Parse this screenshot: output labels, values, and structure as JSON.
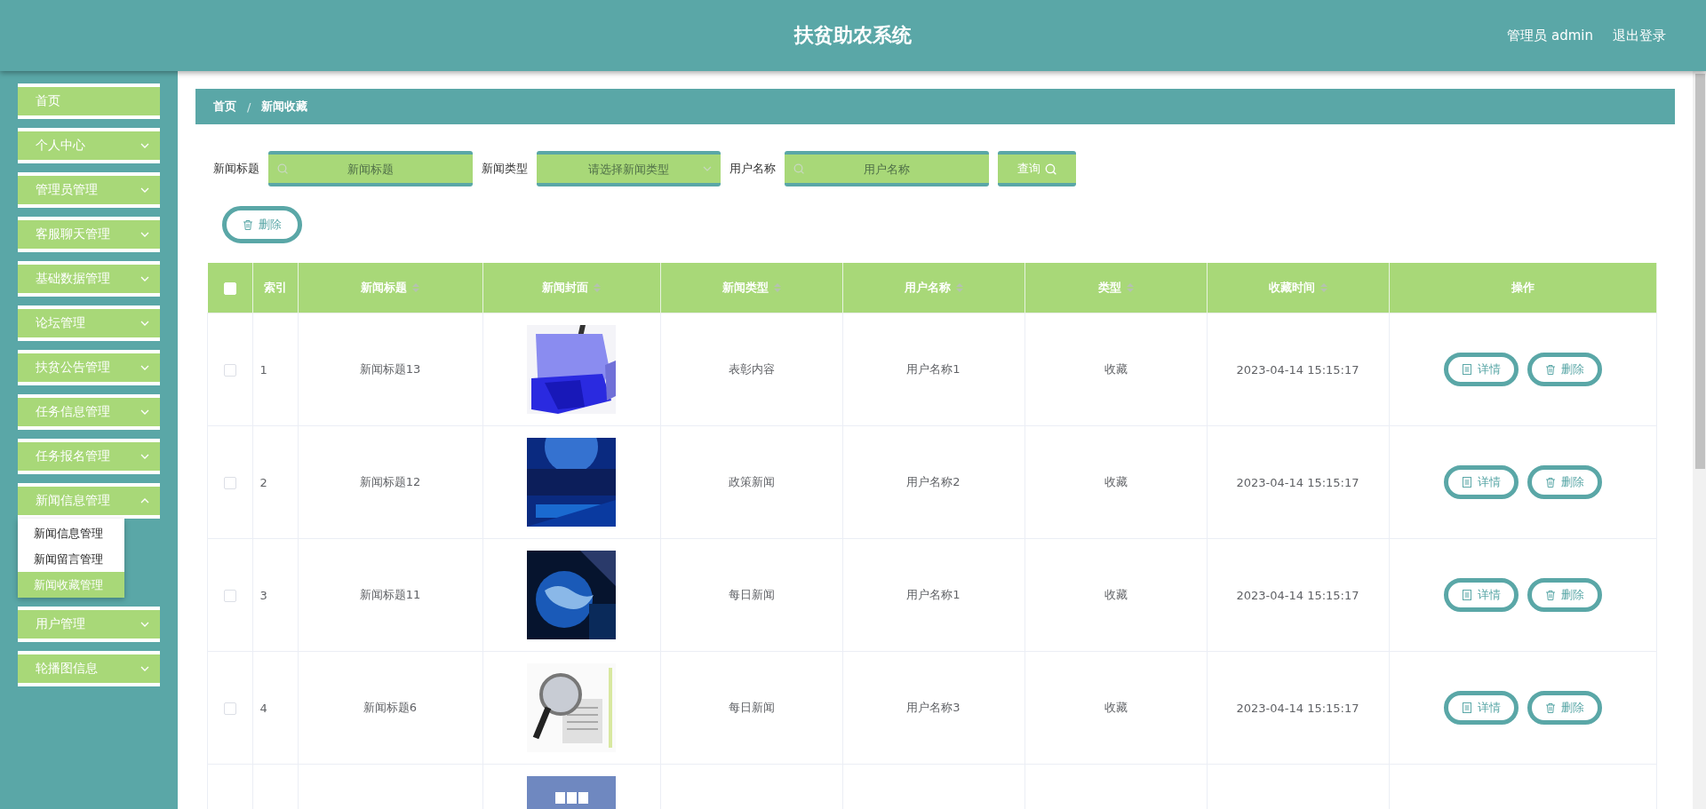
{
  "header": {
    "title": "扶贫助农系统",
    "user": "管理员 admin",
    "logout": "退出登录"
  },
  "sidebar": {
    "items": [
      {
        "label": "首页",
        "selected": false
      },
      {
        "label": "个人中心",
        "selected": false,
        "expanded": false
      },
      {
        "label": "管理员管理",
        "selected": false,
        "expanded": false
      },
      {
        "label": "客服聊天管理",
        "selected": false,
        "expanded": false
      },
      {
        "label": "基础数据管理",
        "selected": false,
        "expanded": false
      },
      {
        "label": "论坛管理",
        "selected": false,
        "expanded": false
      },
      {
        "label": "扶贫公告管理",
        "selected": false,
        "expanded": false
      },
      {
        "label": "任务信息管理",
        "selected": false,
        "expanded": false
      },
      {
        "label": "任务报名管理",
        "selected": false,
        "expanded": false
      },
      {
        "label": "新闻信息管理",
        "selected": false,
        "expanded": true,
        "children": [
          {
            "label": "新闻信息管理",
            "selected": false
          },
          {
            "label": "新闻留言管理",
            "selected": false
          },
          {
            "label": "新闻收藏管理",
            "selected": true
          }
        ]
      },
      {
        "label": "用户管理",
        "selected": false,
        "expanded": false
      },
      {
        "label": "轮播图信息",
        "selected": false,
        "expanded": false
      }
    ]
  },
  "breadcrumb": [
    "首页",
    "/",
    "新闻收藏"
  ],
  "search": {
    "fields": [
      {
        "kind": "input",
        "label": "新闻标题",
        "placeholder": "新闻标题"
      },
      {
        "kind": "select",
        "label": "新闻类型",
        "placeholder": "请选择新闻类型"
      },
      {
        "kind": "input",
        "label": "用户名称",
        "placeholder": "用户名称"
      }
    ],
    "button": "查询"
  },
  "delete_button": "删除",
  "table": {
    "select_all": {
      "checked": false
    },
    "columns": [
      {
        "label": "索引",
        "sortable": false
      },
      {
        "label": "新闻标题",
        "sortable": true
      },
      {
        "label": "新闻封面",
        "sortable": true
      },
      {
        "label": "新闻类型",
        "sortable": true
      },
      {
        "label": "用户名称",
        "sortable": true
      },
      {
        "label": "类型",
        "sortable": true
      },
      {
        "label": "收藏时间",
        "sortable": true
      },
      {
        "label": "操作",
        "sortable": false
      }
    ],
    "rows": [
      {
        "checked": false,
        "index": "1",
        "title": "新闻标题13",
        "cover": {
          "kind": "picture"
        },
        "news_type": "表彰内容",
        "user_name": "用户名称1",
        "type": "收藏",
        "time": "2023-04-14 15:15:17",
        "actions": [
          "详情",
          "删除"
        ]
      },
      {
        "checked": false,
        "index": "2",
        "title": "新闻标题12",
        "cover": {
          "kind": "picture"
        },
        "news_type": "政策新闻",
        "user_name": "用户名称2",
        "type": "收藏",
        "time": "2023-04-14 15:15:17",
        "actions": [
          "详情",
          "删除"
        ]
      },
      {
        "checked": false,
        "index": "3",
        "title": "新闻标题11",
        "cover": {
          "kind": "picture"
        },
        "news_type": "每日新闻",
        "user_name": "用户名称1",
        "type": "收藏",
        "time": "2023-04-14 15:15:17",
        "actions": [
          "详情",
          "删除"
        ]
      },
      {
        "checked": false,
        "index": "4",
        "title": "新闻标题6",
        "cover": {
          "kind": "picture"
        },
        "news_type": "每日新闻",
        "user_name": "用户名称3",
        "type": "收藏",
        "time": "2023-04-14 15:15:17",
        "actions": [
          "详情",
          "删除"
        ]
      },
      {
        "cover": {
          "kind": "picture"
        }
      }
    ]
  }
}
